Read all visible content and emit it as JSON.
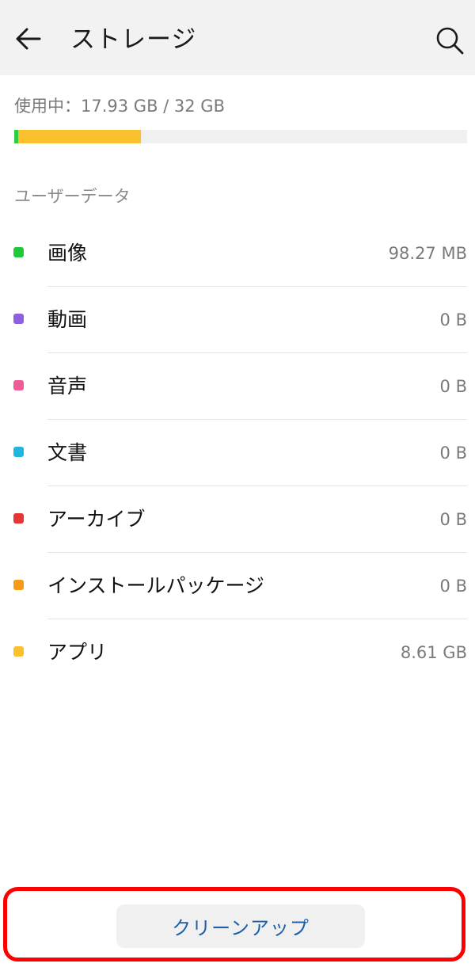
{
  "header": {
    "title": "ストレージ",
    "back_icon": "arrow-left-icon",
    "search_icon": "search-icon"
  },
  "usage": {
    "text": "使用中：17.93 GB / 32 GB",
    "used_gb": 17.93,
    "total_gb": 32,
    "segments": [
      {
        "name": "画像",
        "fraction": 0.009,
        "color": "#2ecc40"
      },
      {
        "name": "アプリ",
        "fraction": 0.27,
        "color": "#fbc02d"
      }
    ]
  },
  "section": {
    "label": "ユーザーデータ"
  },
  "items": [
    {
      "label": "画像",
      "value": "98.27 MB",
      "color": "#1fc93a"
    },
    {
      "label": "動画",
      "value": "0 B",
      "color": "#8e5fe0"
    },
    {
      "label": "音声",
      "value": "0 B",
      "color": "#ef5d96"
    },
    {
      "label": "文書",
      "value": "0 B",
      "color": "#22b5e0"
    },
    {
      "label": "アーカイブ",
      "value": "0 B",
      "color": "#e53535"
    },
    {
      "label": "インストールパッケージ",
      "value": "0 B",
      "color": "#f59b18"
    },
    {
      "label": "アプリ",
      "value": "8.61 GB",
      "color": "#fbc02d"
    }
  ],
  "actions": {
    "cleanup_label": "クリーンアップ"
  },
  "colors": {
    "accent": "#1f5fa8",
    "highlight": "#ff0000"
  }
}
